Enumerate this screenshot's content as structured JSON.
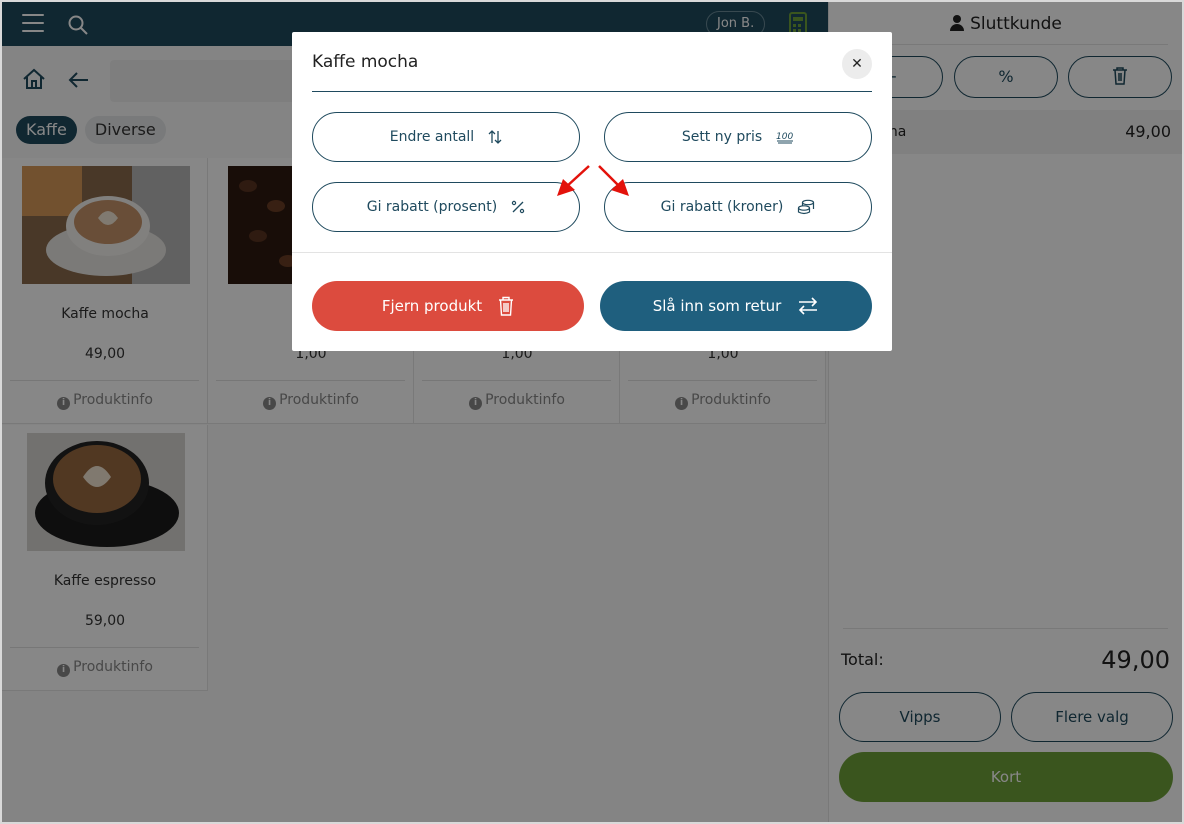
{
  "topbar": {
    "user": "Jon B."
  },
  "categories": [
    "Kaffe",
    "Diverse"
  ],
  "products": [
    {
      "name": "Kaffe mocha",
      "price": "49,00",
      "info": "Produktinfo"
    },
    {
      "name": "",
      "price": "1,00",
      "info": "Produktinfo"
    },
    {
      "name": "",
      "price": "1,00",
      "info": "Produktinfo"
    },
    {
      "name": "",
      "price": "1,00",
      "info": "Produktinfo"
    },
    {
      "name": "Kaffe espresso",
      "price": "59,00",
      "info": "Produktinfo"
    }
  ],
  "cart": {
    "customer": "Sluttkunde",
    "item": {
      "name": "fe mocha",
      "price": "49,00"
    },
    "total_label": "Total:",
    "total_value": "49,00",
    "vipps": "Vipps",
    "more": "Flere valg",
    "kort": "Kort"
  },
  "modal": {
    "title": "Kaffe mocha",
    "options": {
      "change_qty": "Endre antall",
      "new_price": "Sett ny pris",
      "discount_percent": "Gi rabatt (prosent)",
      "discount_kroner": "Gi rabatt (kroner)"
    },
    "remove": "Fjern produkt",
    "return": "Slå inn som retur"
  },
  "colors": {
    "primary": "#1f4a5e",
    "accent_green": "#6fa03a",
    "danger": "#dc4b3e",
    "annotation": "#e3120b"
  }
}
